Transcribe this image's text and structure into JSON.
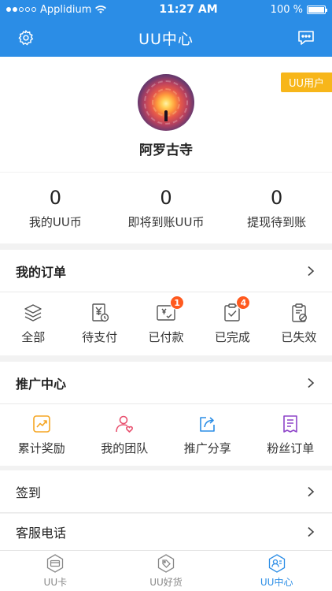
{
  "status_bar": {
    "carrier": "Applidium",
    "time": "11:27 AM",
    "battery": "100 %"
  },
  "navbar": {
    "title": "UU中心",
    "settings_icon": "gear-icon",
    "message_icon": "message-icon"
  },
  "profile": {
    "badge": "UU用户",
    "name": "阿罗古寺"
  },
  "stats": [
    {
      "value": "0",
      "label": "我的UU币"
    },
    {
      "value": "0",
      "label": "即将到账UU币"
    },
    {
      "value": "0",
      "label": "提现待到账"
    }
  ],
  "orders": {
    "title": "我的订单",
    "items": [
      {
        "label": "全部",
        "icon": "layers-icon"
      },
      {
        "label": "待支付",
        "icon": "pending-payment-icon"
      },
      {
        "label": "已付款",
        "icon": "paid-icon",
        "badge": "1"
      },
      {
        "label": "已完成",
        "icon": "completed-icon",
        "badge": "4"
      },
      {
        "label": "已失效",
        "icon": "expired-icon"
      }
    ]
  },
  "promo": {
    "title": "推广中心",
    "items": [
      {
        "label": "累计奖励",
        "icon": "chart-icon",
        "color": "#f5a623"
      },
      {
        "label": "我的团队",
        "icon": "team-icon",
        "color": "#e8506e"
      },
      {
        "label": "推广分享",
        "icon": "share-icon",
        "color": "#2b8de6"
      },
      {
        "label": "粉丝订单",
        "icon": "order-list-icon",
        "color": "#8e44c9"
      }
    ]
  },
  "rows": {
    "checkin": "签到",
    "service": "客服电话"
  },
  "tabbar": [
    {
      "label": "UU卡",
      "icon": "card-icon",
      "active": false
    },
    {
      "label": "UU好货",
      "icon": "tag-icon",
      "active": false
    },
    {
      "label": "UU中心",
      "icon": "user-center-icon",
      "active": true
    }
  ],
  "colors": {
    "primary": "#2b8de6",
    "badge": "#f7b61a",
    "notification": "#ff5a1f"
  }
}
